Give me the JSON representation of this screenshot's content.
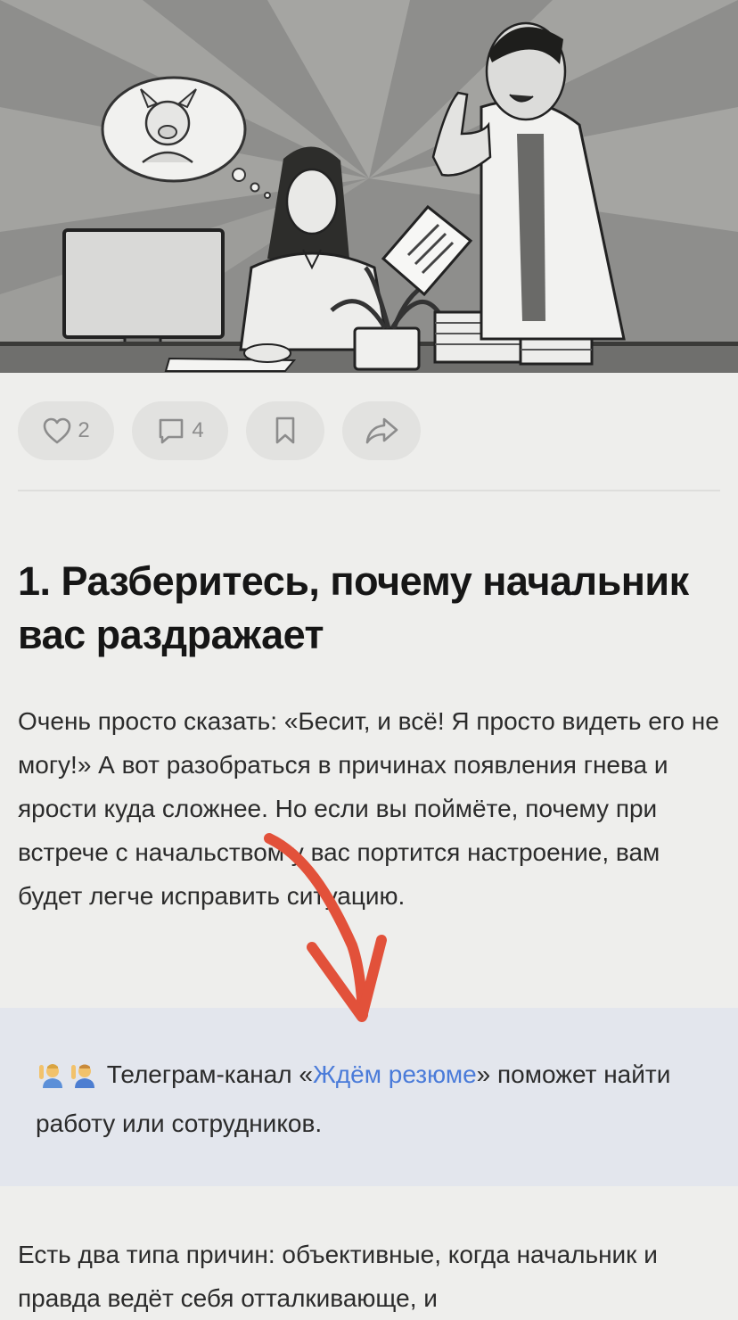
{
  "hero": {
    "image": "office-illustration",
    "description_icon": "angry-boss-illustration"
  },
  "actions": {
    "like_icon": "heart-icon",
    "like_count": "2",
    "comment_icon": "comment-icon",
    "comment_count": "4",
    "bookmark_icon": "bookmark-icon",
    "share_icon": "share-icon"
  },
  "article": {
    "heading": "1. Разберитесь, почему начальник вас раздражает",
    "paragraph1": "Очень просто сказать: «Бесит, и всё! Я просто видеть его не могу!» А вот разобраться в причинах появления гнева и ярости куда сложнее. Но если вы поймёте, почему при встрече с начальством у вас портится настроение, вам будет легче исправить ситуацию.",
    "callout": {
      "emoji_icons": [
        "person-raising-hand-icon",
        "person-raising-hand-icon"
      ],
      "text_before": "Телеграм-канал «",
      "link_text": "Ждём резюме",
      "text_after": "» поможет найти работу или сотрудников."
    },
    "paragraph2": "Есть два типа причин: объективные, когда начальник и правда ведёт себя отталкивающе, и"
  },
  "colors": {
    "background": "#eeeeec",
    "button_bg": "#e2e2e0",
    "callout_bg": "#e3e6ed",
    "link": "#4a7bd9",
    "annotation_arrow": "#e2513a"
  }
}
